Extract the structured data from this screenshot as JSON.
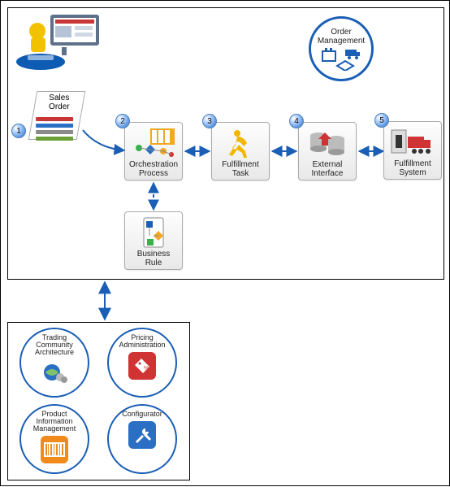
{
  "orderManagementCircle": {
    "label": "Order\nManagement"
  },
  "callouts": [
    "1",
    "2",
    "3",
    "4",
    "5"
  ],
  "nodes": {
    "salesOrder": {
      "label": "Sales\nOrder"
    },
    "orchestration": {
      "label": "Orchestration\nProcess"
    },
    "fulfillmentTask": {
      "label": "Fulfillment\nTask"
    },
    "externalInterface": {
      "label": "External\nInterface"
    },
    "fulfillmentSystem": {
      "label": "Fulfillment\nSystem"
    },
    "businessRule": {
      "label": "Business\nRule"
    }
  },
  "bottomCircles": [
    {
      "label": "Trading\nCommunity\nArchitecture"
    },
    {
      "label": "Pricing\nAdministration"
    },
    {
      "label": "Product\nInformation\nManagement"
    },
    {
      "label": "Configurator"
    }
  ],
  "connectors": [
    {
      "from": "salesOrder",
      "to": "orchestration",
      "style": "arrow"
    },
    {
      "from": "orchestration",
      "to": "fulfillmentTask",
      "style": "double-arrow"
    },
    {
      "from": "fulfillmentTask",
      "to": "externalInterface",
      "style": "double-arrow"
    },
    {
      "from": "externalInterface",
      "to": "fulfillmentSystem",
      "style": "double-arrow"
    },
    {
      "from": "orchestration",
      "to": "businessRule",
      "style": "dashed-double-arrow"
    },
    {
      "from": "mainBox",
      "to": "bottomBox",
      "style": "double-arrow"
    }
  ],
  "colors": {
    "accentBlue": "#1a5eb5",
    "nodeGradientTop": "#fefefe",
    "nodeGradientBottom": "#e8e8e8",
    "redIcon": "#cf3333",
    "orangeIcon": "#f08a1d",
    "yellowIcon": "#f3b600",
    "greenIcon": "#36b24a"
  }
}
